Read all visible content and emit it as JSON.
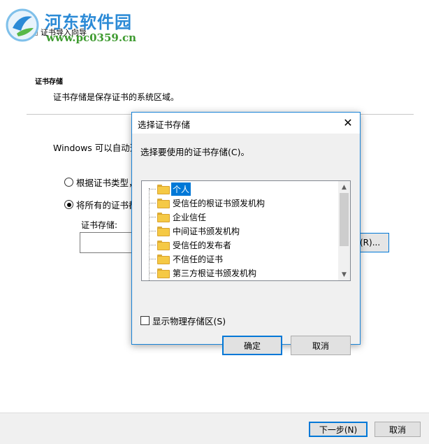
{
  "watermark": {
    "name": "河东软件园",
    "url": "www.pc0359.cn"
  },
  "wizard": {
    "title": "证书导入向导",
    "section_heading": "证书存储",
    "section_desc": "证书存储是保存证书的系统区域。",
    "body_text": "Windows 可以自动选",
    "radio_auto": "根据证书类型，",
    "radio_manual": "将所有的证书都",
    "store_label": "证书存储:",
    "store_value": "",
    "browse_label": "(R)...",
    "next_label": "下一步(N)",
    "cancel_label": "取消"
  },
  "dialog": {
    "title": "选择证书存储",
    "close_glyph": "✕",
    "prompt": "选择要使用的证书存储(C)。",
    "stores": [
      "个人",
      "受信任的根证书颁发机构",
      "企业信任",
      "中间证书颁发机构",
      "受信任的发布者",
      "不信任的证书",
      "第三方根证书颁发机构"
    ],
    "selected_index": 0,
    "show_physical_label": "显示物理存储区(S)",
    "show_physical_checked": false,
    "ok_label": "确定",
    "cancel_label": "取消"
  },
  "colors": {
    "accent": "#0078d7",
    "folder": "#f5c945"
  },
  "icons": {
    "folder": "folder-icon",
    "close": "close-icon",
    "scroll_up": "scroll-up-icon",
    "scroll_down": "scroll-down-icon"
  }
}
